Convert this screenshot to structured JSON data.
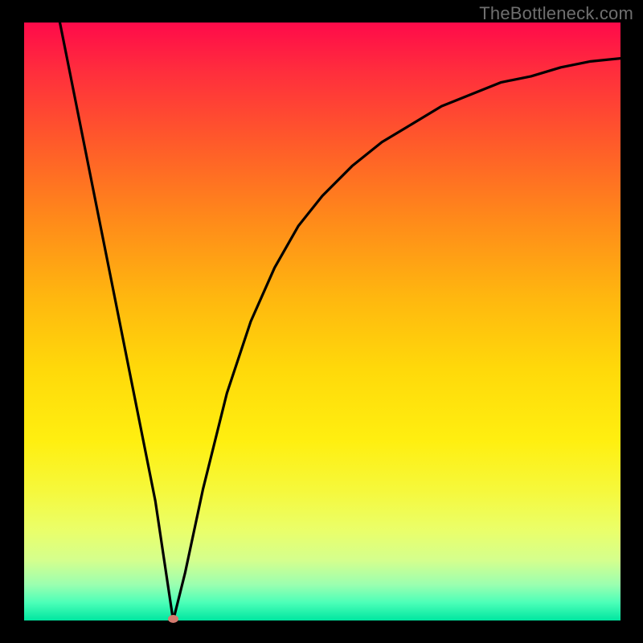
{
  "watermark": "TheBottleneck.com",
  "chart_data": {
    "type": "line",
    "title": "",
    "xlabel": "",
    "ylabel": "",
    "xlim": [
      0,
      100
    ],
    "ylim": [
      0,
      100
    ],
    "series": [
      {
        "name": "bottleneck-curve",
        "x": [
          6,
          10,
          14,
          18,
          22,
          23.5,
          25,
          27,
          30,
          34,
          38,
          42,
          46,
          50,
          55,
          60,
          65,
          70,
          75,
          80,
          85,
          90,
          95,
          100
        ],
        "values": [
          100,
          80,
          60,
          40,
          20,
          10,
          0,
          8,
          22,
          38,
          50,
          59,
          66,
          71,
          76,
          80,
          83,
          86,
          88,
          90,
          91,
          92.5,
          93.5,
          94
        ]
      }
    ],
    "marker": {
      "x": 25,
      "y": 0
    }
  },
  "colors": {
    "background": "#000000",
    "curve": "#000000",
    "marker": "#d47b6f",
    "gradient_top": "#ff0a4a",
    "gradient_bottom": "#00e6a0"
  }
}
